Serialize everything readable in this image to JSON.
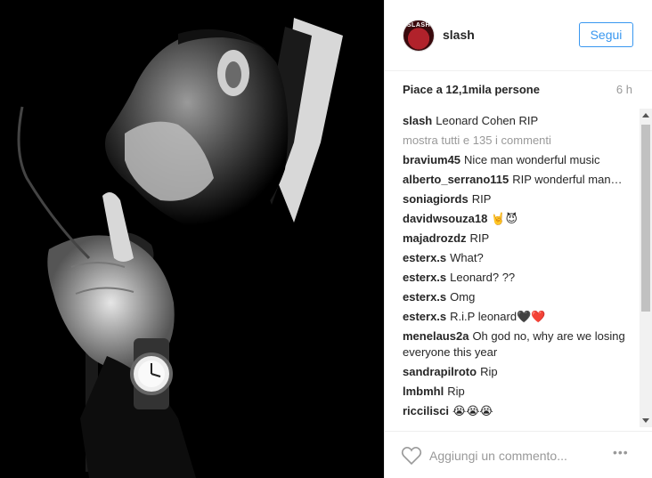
{
  "header": {
    "avatar_text": "SLASH",
    "username": "slash",
    "follow_label": "Segui"
  },
  "stats": {
    "likes": "Piace a 12,1mila persone",
    "time": "6 h"
  },
  "caption": {
    "user": "slash",
    "text": "Leonard Cohen RIP"
  },
  "show_all_comments": "mostra tutti e 135 i commenti",
  "comments": [
    {
      "user": "bravium45",
      "text": "Nice man wonderful music"
    },
    {
      "user": "alberto_serrano115",
      "text": "RIP wonderful man…"
    },
    {
      "user": "soniagiords",
      "text": "RIP"
    },
    {
      "user": "davidwsouza18",
      "text": "🤘😈"
    },
    {
      "user": "majadrozdz",
      "text": "RIP"
    },
    {
      "user": "esterx.s",
      "text": "What?"
    },
    {
      "user": "esterx.s",
      "text": "Leonard? ??"
    },
    {
      "user": "esterx.s",
      "text": "Omg"
    },
    {
      "user": "esterx.s",
      "text": "R.i.P leonard🖤❤️"
    },
    {
      "user": "menelaus2a",
      "text": "Oh god no, why are we losing everyone this year"
    },
    {
      "user": "sandrapilroto",
      "text": "Rip"
    },
    {
      "user": "lmbmhl",
      "text": "Rip"
    },
    {
      "user": "riccilisci",
      "text": "😭😭😭"
    }
  ],
  "footer": {
    "comment_placeholder": "Aggiungi un commento...",
    "options_label": "•••"
  },
  "colors": {
    "accent": "#3897f0",
    "muted": "#999999",
    "text": "#262626",
    "like_icon": "#999999"
  }
}
